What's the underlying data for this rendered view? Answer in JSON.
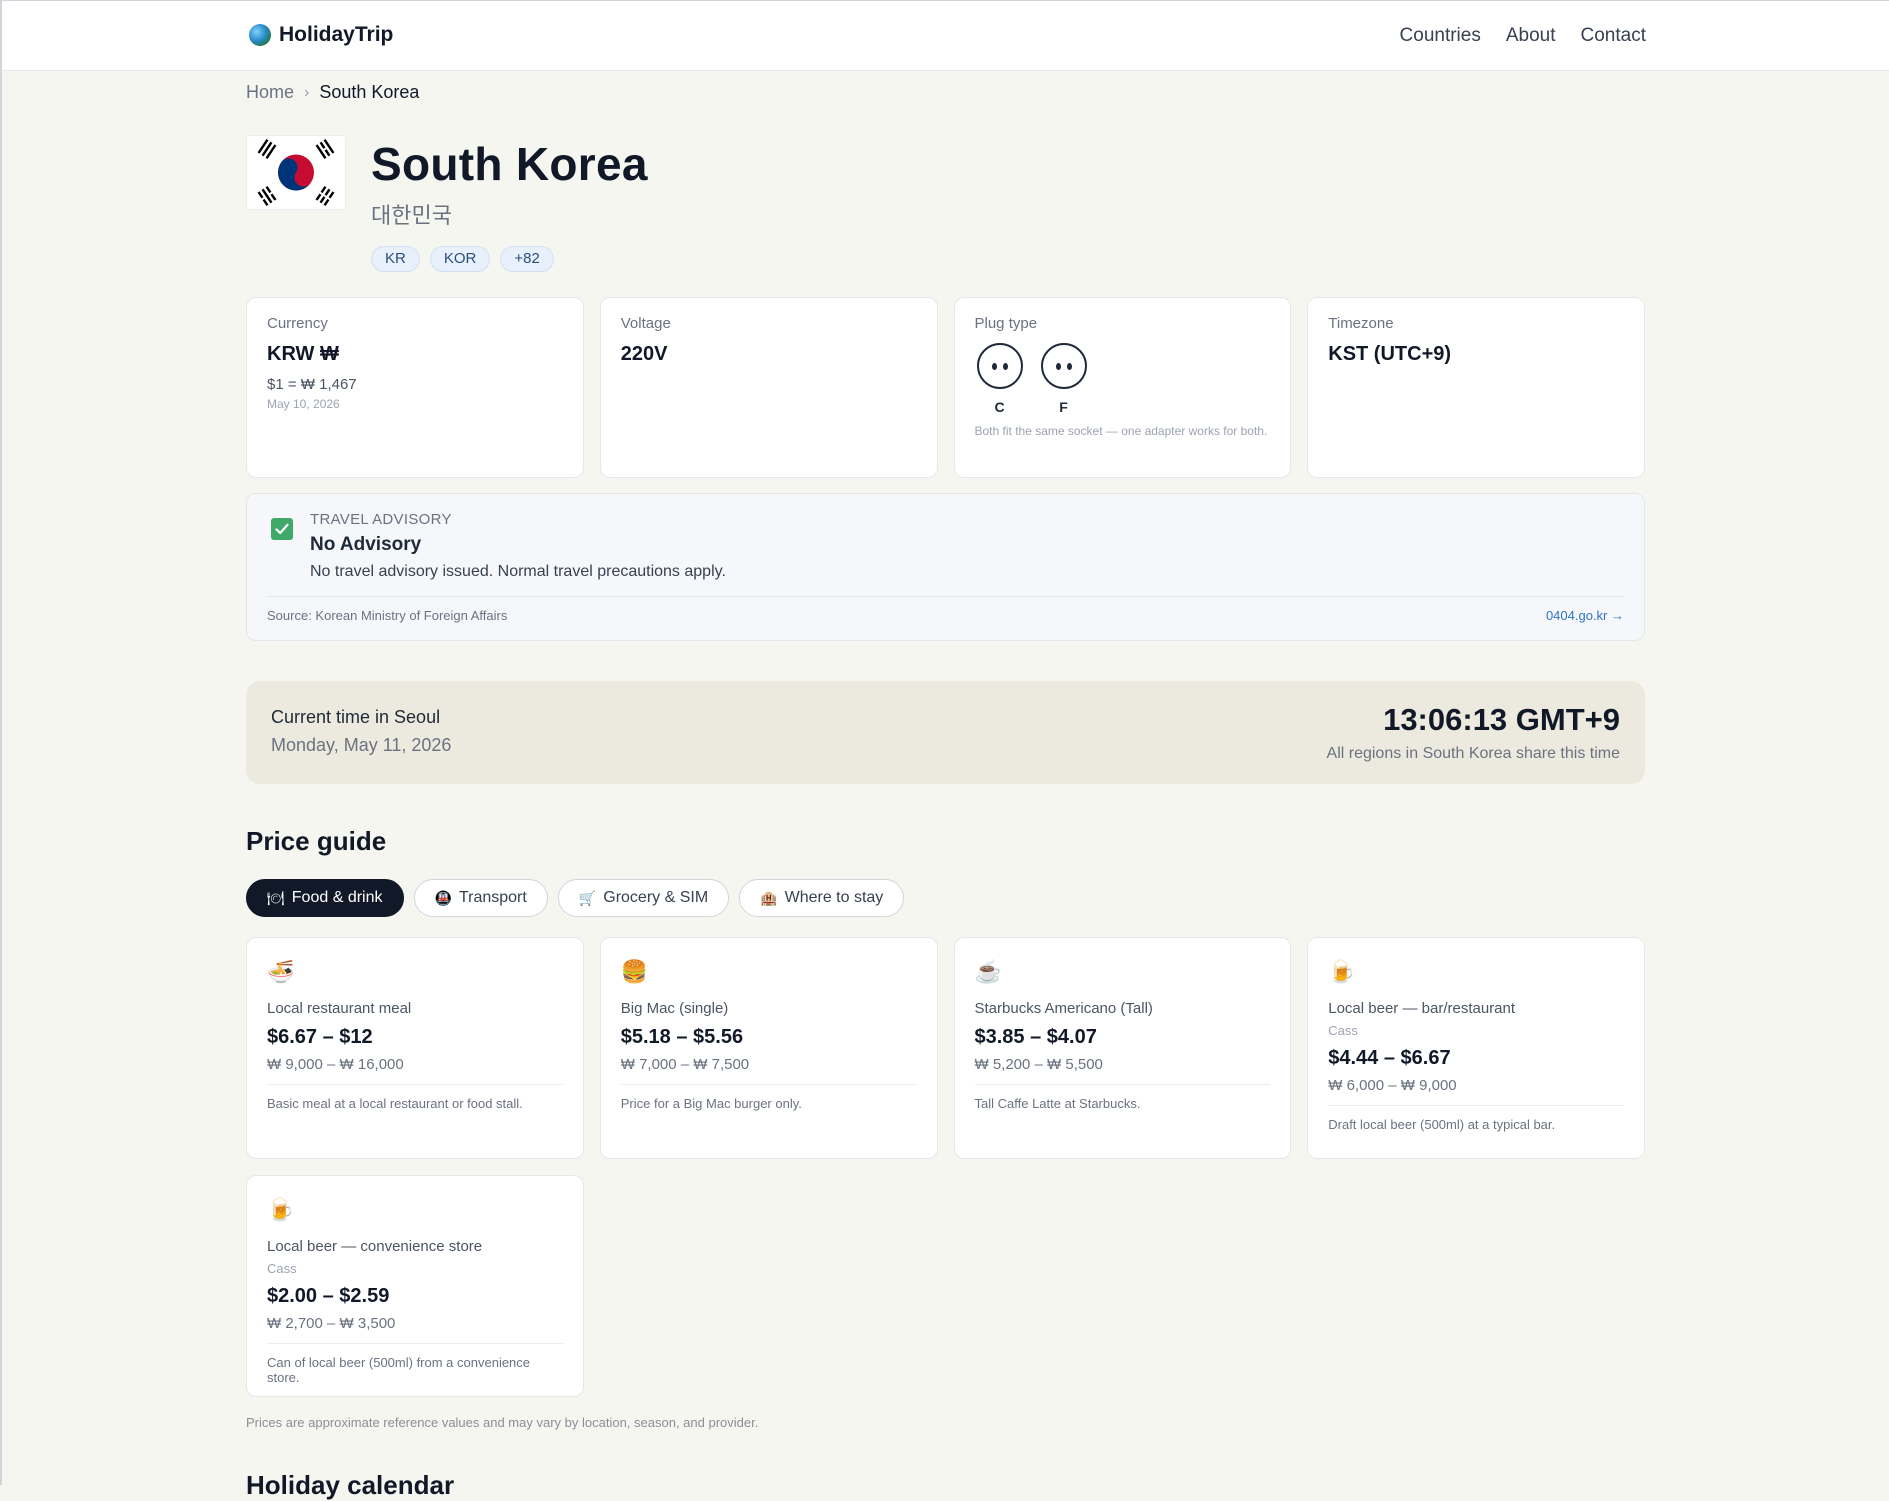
{
  "header": {
    "brand": "HolidayTrip",
    "nav": [
      "Countries",
      "About",
      "Contact"
    ]
  },
  "breadcrumb": {
    "home": "Home",
    "separator": "›",
    "current": "South Korea"
  },
  "country": {
    "name": "South Korea",
    "native_name": "대한민국",
    "tags": [
      "KR",
      "KOR",
      "+82"
    ]
  },
  "facts": {
    "currency": {
      "label": "Currency",
      "value": "KRW ₩",
      "rate": "$1 = ₩ 1,467",
      "date": "May 10, 2026"
    },
    "voltage": {
      "label": "Voltage",
      "value": "220V"
    },
    "plug": {
      "label": "Plug type",
      "types": [
        "C",
        "F"
      ],
      "note": "Both fit the same socket — one adapter works for both."
    },
    "timezone": {
      "label": "Timezone",
      "value": "KST (UTC+9)"
    }
  },
  "advisory": {
    "kicker": "TRAVEL ADVISORY",
    "title": "No Advisory",
    "description": "No travel advisory issued. Normal travel precautions apply.",
    "source": "Source: Korean Ministry of Foreign Affairs",
    "link": "0404.go.kr →"
  },
  "clock": {
    "label": "Current time in Seoul",
    "date": "Monday, May 11, 2026",
    "time": "13:06:13 GMT+9",
    "note": "All regions in South Korea share this time"
  },
  "price_guide": {
    "title": "Price guide",
    "tabs": [
      {
        "icon": "🍽",
        "label": "Food & drink"
      },
      {
        "icon": "🚇",
        "label": "Transport"
      },
      {
        "icon": "🛒",
        "label": "Grocery & SIM"
      },
      {
        "icon": "🏨",
        "label": "Where to stay"
      }
    ],
    "items": [
      {
        "icon": "🍜",
        "name": "Local restaurant meal",
        "brand": "",
        "usd": "$6.67 – $12",
        "krw": "₩ 9,000 – ₩ 16,000",
        "note": "Basic meal at a local restaurant or food stall."
      },
      {
        "icon": "🍔",
        "name": "Big Mac (single)",
        "brand": "",
        "usd": "$5.18 – $5.56",
        "krw": "₩ 7,000 – ₩ 7,500",
        "note": "Price for a Big Mac burger only."
      },
      {
        "icon": "☕",
        "name": "Starbucks Americano (Tall)",
        "brand": "",
        "usd": "$3.85 – $4.07",
        "krw": "₩ 5,200 – ₩ 5,500",
        "note": "Tall Caffe Latte at Starbucks."
      },
      {
        "icon": "🍺",
        "name": "Local beer — bar/restaurant",
        "brand": "Cass",
        "usd": "$4.44 – $6.67",
        "krw": "₩ 6,000 – ₩ 9,000",
        "note": "Draft local beer (500ml) at a typical bar."
      },
      {
        "icon": "🍺",
        "name": "Local beer — convenience store",
        "brand": "Cass",
        "usd": "$2.00 – $2.59",
        "krw": "₩ 2,700 – ₩ 3,500",
        "note": "Can of local beer (500ml) from a convenience store."
      }
    ],
    "footnote": "Prices are approximate reference values and may vary by location, season, and provider."
  },
  "next_section": {
    "title": "Holiday calendar"
  }
}
